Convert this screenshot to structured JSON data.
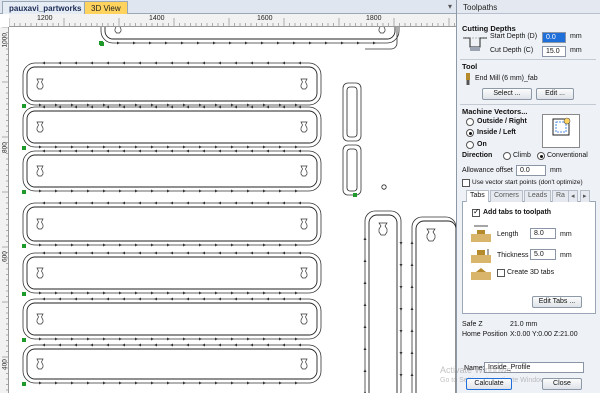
{
  "document_tabs": {
    "doc_name": "pauxavi_partworks",
    "view3d": "3D View"
  },
  "ruler": {
    "top_labels": [
      "1200",
      "1400",
      "1600",
      "1800"
    ],
    "left_labels": [
      "1000",
      "800",
      "600",
      "400"
    ]
  },
  "panel": {
    "title": "Toolpaths",
    "cutting_depths": {
      "title": "Cutting Depths",
      "start_label": "Start Depth (D)",
      "start_value": "0.0",
      "start_unit": "mm",
      "cut_label": "Cut Depth (C)",
      "cut_value": "15.0",
      "cut_unit": "mm"
    },
    "tool": {
      "title": "Tool",
      "name": "End Mill (6 mm)_fab",
      "select_label": "Select ...",
      "edit_label": "Edit ..."
    },
    "machine_vectors": {
      "title": "Machine Vectors...",
      "opt_outside": "Outside / Right",
      "opt_inside": "Inside / Left",
      "opt_on": "On",
      "selected": "Inside / Left"
    },
    "direction": {
      "title": "Direction",
      "climb": "Climb",
      "conventional": "Conventional",
      "selected": "Conventional"
    },
    "allowance": {
      "label": "Allowance offset",
      "value": "0.0",
      "unit": "mm"
    },
    "use_vector_start": "Use vector start points (don't optimize)",
    "subtabs": [
      "Tabs",
      "Corners",
      "Leads",
      "Ra"
    ],
    "tabs": {
      "add_tabs_label": "Add tabs to toolpath",
      "length_label": "Length",
      "length_value": "8.0",
      "length_unit": "mm",
      "thickness_label": "Thickness",
      "thickness_value": "5.0",
      "thickness_unit": "mm",
      "create3d_label": "Create 3D tabs",
      "edit_tabs_label": "Edit Tabs ..."
    },
    "safe_z": {
      "label": "Safe Z",
      "value": "21.0 mm"
    },
    "home_position": {
      "label": "Home Position",
      "value": "X:0.00 Y:0.00 Z:21.00"
    },
    "name": {
      "label": "Name:",
      "value": "Inside_Profile"
    },
    "calculate_label": "Calculate",
    "close_label": "Close"
  },
  "watermark": {
    "line1": "Activate Windows",
    "line2": "Go to Settings to activate Windows."
  },
  "colors": {
    "accent": "#ffd35e",
    "selection": "#1e6fd9",
    "node": "#1f9a2a"
  }
}
